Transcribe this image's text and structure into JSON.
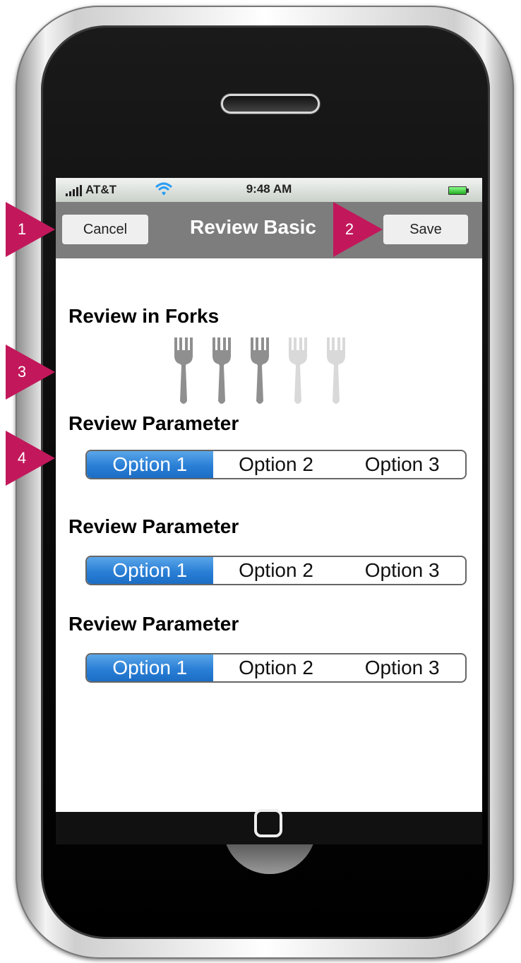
{
  "status_bar": {
    "carrier": "AT&T",
    "time": "9:48 AM"
  },
  "nav_bar": {
    "title": "Review Basic",
    "cancel_label": "Cancel",
    "save_label": "Save"
  },
  "sections": {
    "forks_heading": "Review in Forks",
    "fork_rating": {
      "filled": 3,
      "total": 5
    },
    "params": [
      {
        "heading": "Review Parameter",
        "options": [
          "Option 1",
          "Option 2",
          "Option 3"
        ],
        "selected": 0
      },
      {
        "heading": "Review Parameter",
        "options": [
          "Option 1",
          "Option 2",
          "Option 3"
        ],
        "selected": 0
      },
      {
        "heading": "Review Parameter",
        "options": [
          "Option 1",
          "Option 2",
          "Option 3"
        ],
        "selected": 0
      }
    ]
  },
  "annotations": [
    "1",
    "2",
    "3",
    "4"
  ],
  "icons": {
    "signal": "signal-bars-icon",
    "wifi": "wifi-icon",
    "battery": "battery-icon",
    "fork": "fork-icon",
    "home": "home-button-icon"
  },
  "colors": {
    "nav_bar": "#7d7d7d",
    "segment_selected": "#2a7fd6",
    "marker": "#c2185b"
  }
}
